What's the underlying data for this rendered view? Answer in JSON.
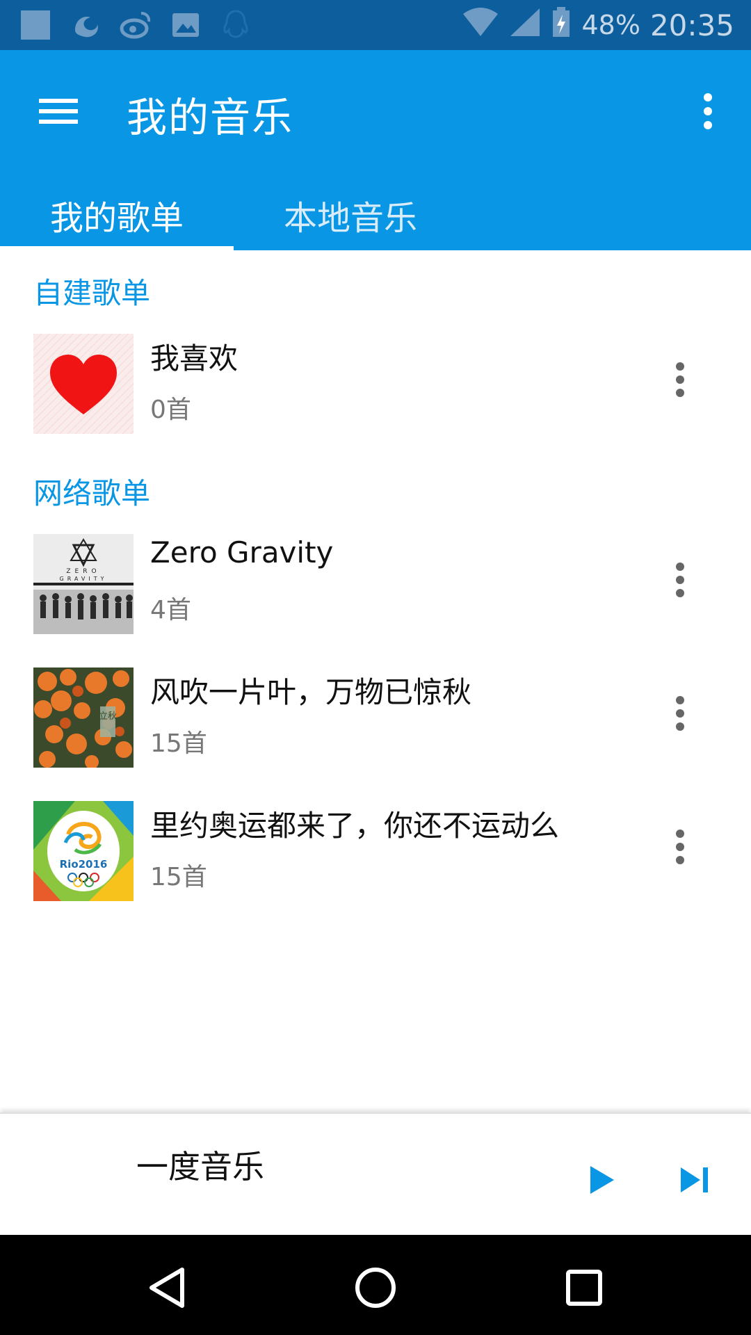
{
  "status_bar": {
    "battery": "48%",
    "time": "20:35",
    "icons": [
      "app-icon",
      "uc-browser-icon",
      "weibo-icon",
      "image-icon",
      "qq-icon",
      "wifi-icon",
      "signal-icon",
      "battery-charging-icon"
    ]
  },
  "app_bar": {
    "title": "我的音乐",
    "menu_icon": "hamburger-menu-icon",
    "more_icon": "more-vert-icon",
    "background": "#0996e4"
  },
  "tabs": [
    {
      "label": "我的歌单",
      "active": true
    },
    {
      "label": "本地音乐",
      "active": false
    }
  ],
  "sections": {
    "custom": {
      "header": "自建歌单",
      "items": [
        {
          "title": "我喜欢",
          "count": "0首",
          "cover": "heart-cover"
        }
      ]
    },
    "online": {
      "header": "网络歌单",
      "items": [
        {
          "title": "Zero Gravity",
          "count": "4首",
          "cover": "zero-gravity-cover"
        },
        {
          "title": "风吹一片叶，万物已惊秋",
          "count": "15首",
          "cover": "autumn-leaves-cover"
        },
        {
          "title": "里约奥运都来了，你还不运动么",
          "count": "15首",
          "cover": "rio-2016-cover"
        }
      ]
    }
  },
  "player": {
    "title": "一度音乐",
    "play_icon": "play-icon",
    "next_icon": "skip-next-icon"
  },
  "nav_bar": {
    "icons": [
      "back-icon",
      "home-icon",
      "recents-icon"
    ]
  },
  "covers": {
    "zero_line1": "ZERO",
    "zero_line2": "GRAVITY",
    "autumn_stamp": "立秋",
    "rio_text": "Rio2016"
  },
  "colors": {
    "accent": "#0996e4",
    "status_bar": "#0c5e9c",
    "heart": "#f01414"
  }
}
